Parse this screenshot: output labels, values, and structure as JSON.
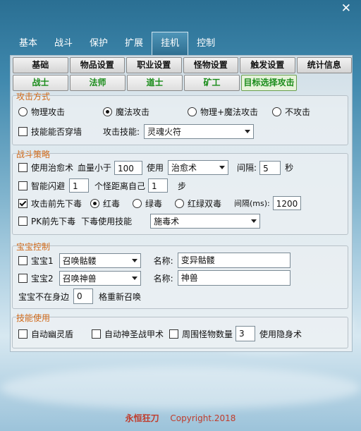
{
  "window": {
    "close_label": "✕"
  },
  "tabs": [
    "基本",
    "战斗",
    "保护",
    "扩展",
    "挂机",
    "控制"
  ],
  "active_tab": "挂机",
  "subtabs_row1": [
    "基础",
    "物品设置",
    "职业设置",
    "怪物设置",
    "触发设置",
    "统计信息"
  ],
  "subtabs_row2": [
    "战士",
    "法师",
    "道士",
    "矿工",
    "目标选择攻击"
  ],
  "attack": {
    "title": "攻击方式",
    "modes": [
      "物理攻击",
      "魔法攻击",
      "物理+魔法攻击",
      "不攻击"
    ],
    "selected": "魔法攻击",
    "pierce_label": "技能能否穿墙",
    "skill_label": "攻击技能:",
    "skill_value": "灵魂火符"
  },
  "strategy": {
    "title": "战斗策略",
    "heal_label": "使用治愈术",
    "hp_below_label": "血量小于",
    "hp_value": "100",
    "use_label": "使用",
    "heal_skill": "治愈术",
    "interval_label": "间隔:",
    "interval_value": "5",
    "sec_label": "秒",
    "dodge_label": "智能闪避",
    "dodge_count": "1",
    "dodge_mid": "个怪距离自己",
    "dodge_dist": "1",
    "step_label": "步",
    "poison_label": "攻击前先下毒",
    "poison_options": [
      "红毒",
      "绿毒",
      "红绿双毒"
    ],
    "poison_selected": "红毒",
    "poison_interval_label": "间隔(ms):",
    "poison_interval_value": "1200",
    "pk_poison_label": "PK前先下毒",
    "pk_skill_label": "下毒使用技能",
    "pk_skill_value": "施毒术"
  },
  "pet": {
    "title": "宝宝控制",
    "pet1_label": "宝宝1",
    "pet1_skill": "召唤骷髅",
    "pet1_name_label": "名称:",
    "pet1_name": "变异骷髅",
    "pet2_label": "宝宝2",
    "pet2_skill": "召唤神兽",
    "pet2_name_label": "名称:",
    "pet2_name": "神兽",
    "absent_label": "宝宝不在身边",
    "absent_value": "0",
    "resummon_label": "格重新召唤"
  },
  "skills": {
    "title": "技能使用",
    "ghost_shield": "自动幽灵盾",
    "holy_armor": "自动神圣战甲术",
    "monster_count_label": "周围怪物数量",
    "monster_count": "3",
    "invis_label": "使用隐身术"
  },
  "footer": {
    "brand": "永恒狂刀",
    "copyright": "Copyright.2018"
  }
}
